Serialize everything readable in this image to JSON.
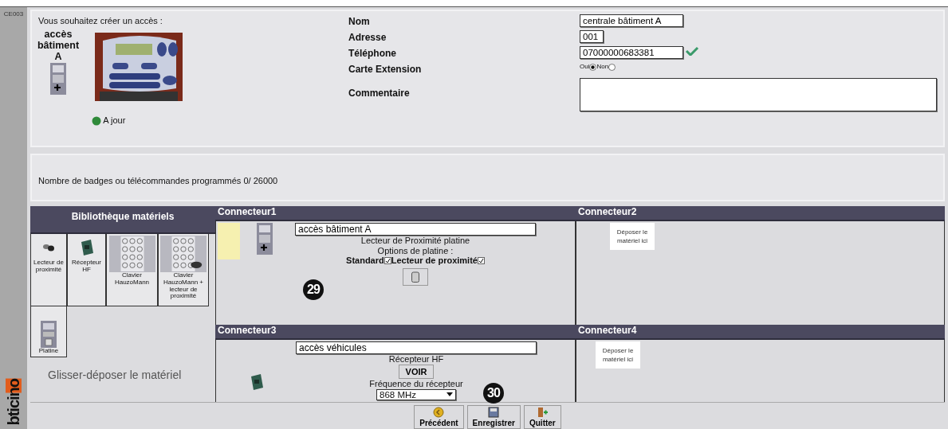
{
  "window": {
    "code": "CE003"
  },
  "brand": "bticino",
  "intro": {
    "prompt": "Vous souhaitez créer un accès :",
    "access_name": "accès bâtiment A",
    "status": "A jour",
    "up_to_date": true
  },
  "form": {
    "fields": [
      {
        "kind": "text",
        "label": "Nom",
        "value": "centrale bâtiment A"
      },
      {
        "kind": "short",
        "label": "Adresse",
        "value": "001"
      },
      {
        "kind": "text",
        "label": "Téléphone",
        "value": "07000000683381",
        "valid": true
      },
      {
        "kind": "radio",
        "label": "Carte Extension",
        "options": [
          {
            "label": "Oui",
            "selected": true
          },
          {
            "label": "Non",
            "selected": false
          }
        ]
      },
      {
        "kind": "textarea",
        "label": "Commentaire"
      }
    ]
  },
  "badge_count": "Nombre de badges ou télécommandes programmés 0/ 26000",
  "library": {
    "title": "Bibliothèque matériels",
    "items": [
      {
        "kind": "reader",
        "label": "Lecteur de proximité"
      },
      {
        "kind": "receiver",
        "label": "Récepteur HF"
      },
      {
        "kind": "keypad",
        "label": "Clavier HauzoMann"
      },
      {
        "kind": "keypad_reader",
        "label": "Clavier HauzoMann + lecteur de proximité"
      },
      {
        "kind": "platine",
        "label": "Platine"
      }
    ],
    "hint": "Glisser-déposer le matériel"
  },
  "connectors": [
    {
      "kind": "platine",
      "title": "Connecteur1",
      "name": "accès bâtiment A",
      "device": "Lecteur de Proximité platine",
      "options_label": "Options de platine :",
      "options": [
        {
          "label": "Standard",
          "checked": true
        },
        {
          "label": "Lecteur de proximité",
          "checked": true
        }
      ]
    },
    {
      "kind": "empty",
      "title": "Connecteur2",
      "drop_hint": "Déposer le matériel ici"
    },
    {
      "kind": "receiver",
      "title": "Connecteur3",
      "name": "accès véhicules",
      "device": "Récepteur HF",
      "view_button": "VOIR",
      "frequency_label": "Fréquence du récepteur",
      "frequency": "868 MHz"
    },
    {
      "kind": "empty",
      "title": "Connecteur4",
      "drop_hint": "Déposer le matériel ici"
    }
  ],
  "callouts": [
    "29",
    "30"
  ],
  "buttons": [
    {
      "kind": "back",
      "label": "Précédent"
    },
    {
      "kind": "save",
      "label": "Enregistrer"
    },
    {
      "kind": "quit",
      "label": "Quitter"
    }
  ]
}
